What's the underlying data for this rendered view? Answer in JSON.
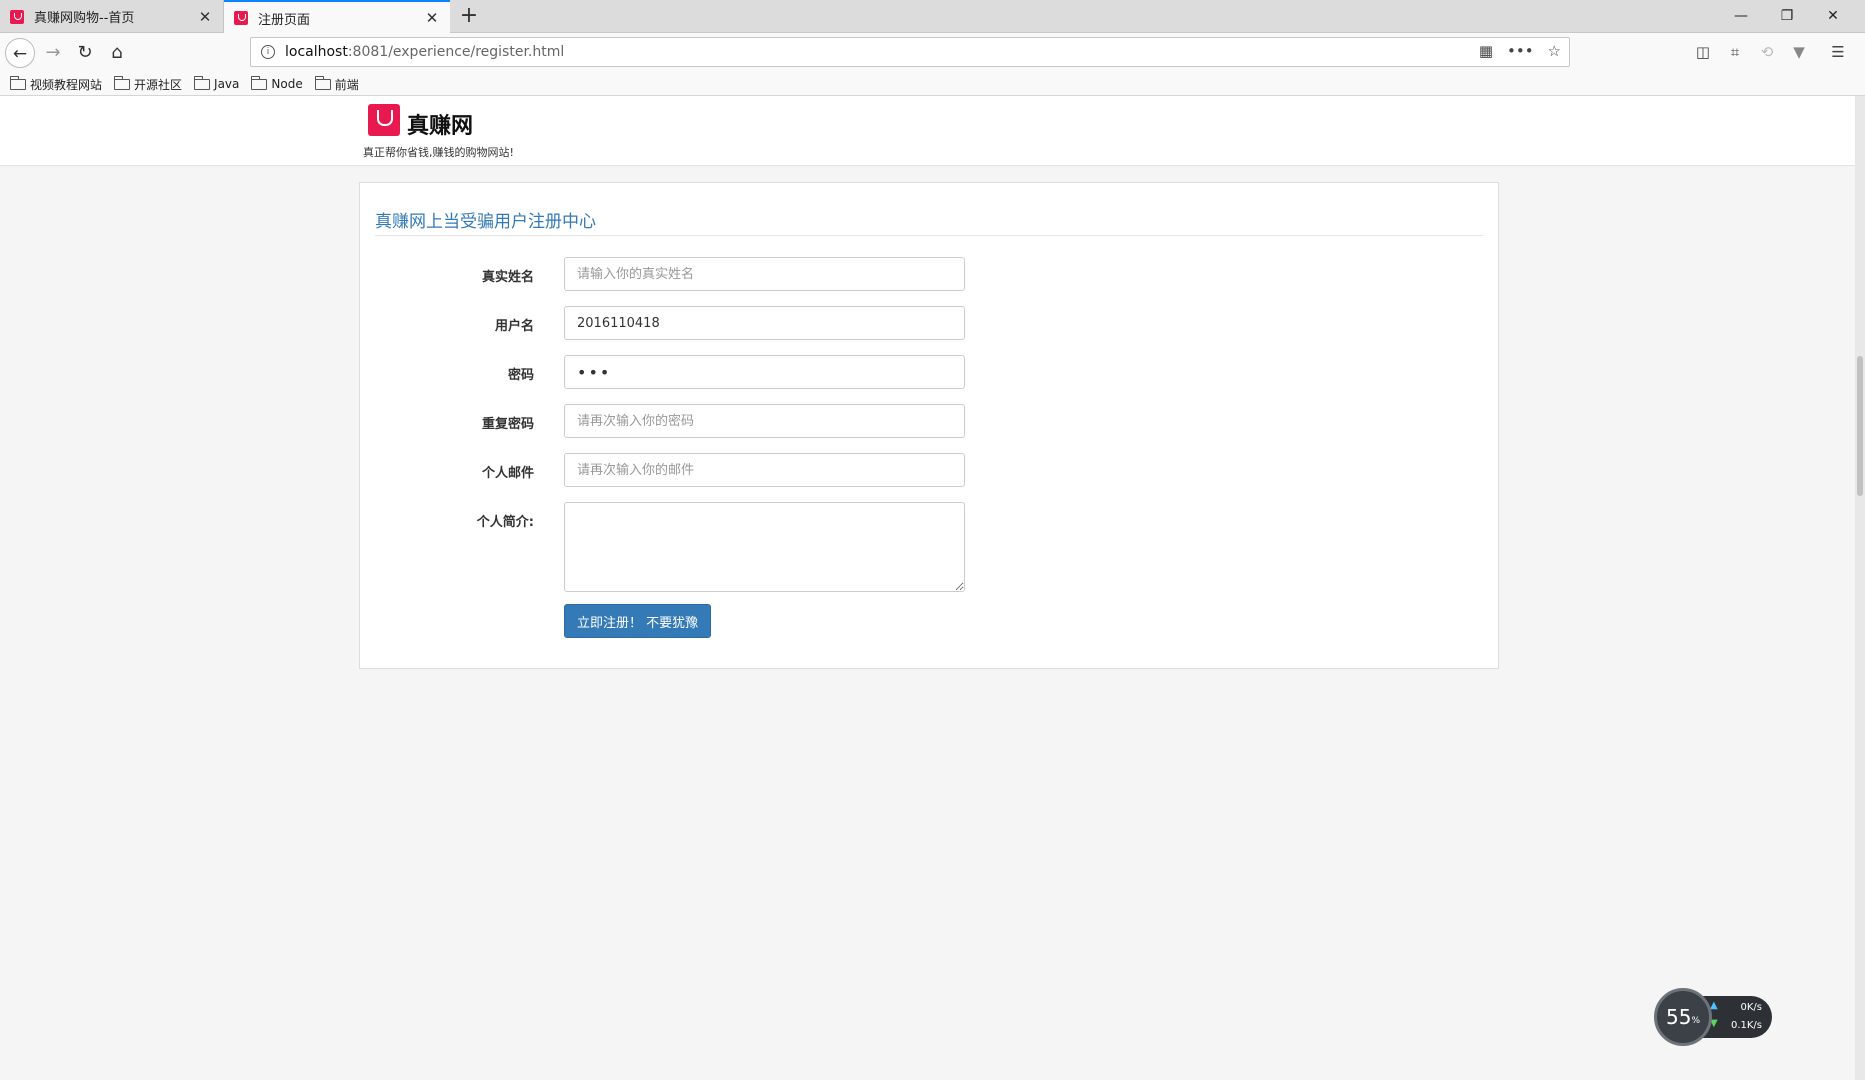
{
  "browser": {
    "tabs": [
      {
        "title": "真赚网购物--首页",
        "close": "✕"
      },
      {
        "title": "注册页面",
        "close": "✕"
      }
    ],
    "new_tab": "+",
    "window_controls": {
      "minimize": "—",
      "restore": "❐",
      "close": "✕"
    },
    "nav": {
      "back": "←",
      "forward": "→",
      "reload": "↻",
      "home": "⌂"
    },
    "url": {
      "info": "i",
      "host": "localhost",
      "path": ":8081/experience/register.html"
    },
    "url_icons": {
      "qr": "▦",
      "more": "•••",
      "star": "☆"
    },
    "toolbar_icons": {
      "sidebar": "◫",
      "crop": "⌗",
      "sync": "⟲",
      "vpn": "▼",
      "menu": "☰"
    },
    "bookmarks": [
      "视频教程网站",
      "开源社区",
      "Java",
      "Node",
      "前端"
    ]
  },
  "site": {
    "name": "真赚网",
    "slogan": "真正帮你省钱,赚钱的购物网站!",
    "brand_color": "#e8194f"
  },
  "form": {
    "title": "真赚网上当受骗用户注册中心",
    "fields": [
      {
        "label": "真实姓名",
        "value": "",
        "placeholder": "请输入你的真实姓名"
      },
      {
        "label": "用户名",
        "value": "2016110418",
        "placeholder": ""
      },
      {
        "label": "密码",
        "value": "•••",
        "placeholder": ""
      },
      {
        "label": "重复密码",
        "value": "",
        "placeholder": "请再次输入你的密码"
      },
      {
        "label": "个人邮件",
        "value": "",
        "placeholder": "请再次输入你的邮件"
      },
      {
        "label": "个人简介:",
        "value": "",
        "placeholder": ""
      }
    ],
    "submit_label": "立即注册！ 不要犹豫",
    "accent_color": "#337ab7"
  },
  "net_widget": {
    "percent": "55",
    "percent_unit": "%",
    "upload": "0K/s",
    "download": "0.1K/s"
  }
}
